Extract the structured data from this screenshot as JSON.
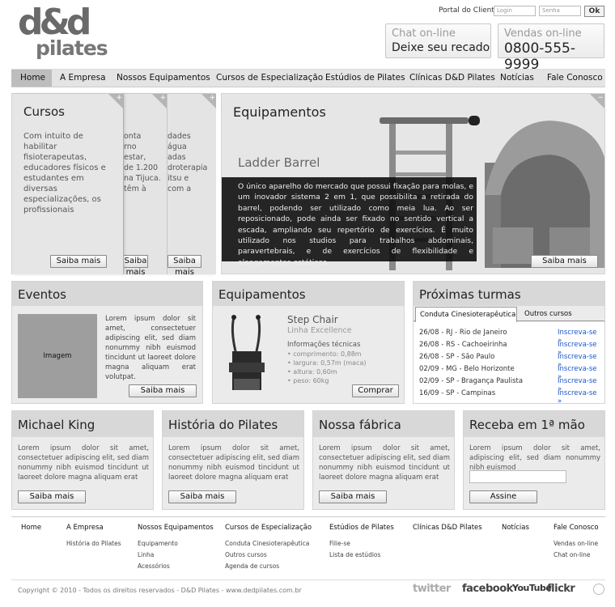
{
  "header": {
    "logo_text": "d&d",
    "logo_sub": "pilates",
    "portal_label": "Portal do Cliente:",
    "login_placeholder": "Login",
    "password_placeholder": "Senha",
    "ok_label": "Ok",
    "chat_line1": "Chat on-line",
    "chat_line2": "Deixe seu recado",
    "sales_line1": "Vendas on-line",
    "sales_line2": "0800-555-9999"
  },
  "nav": [
    "Home",
    "A Empresa",
    "Nossos Equipamentos",
    "Cursos de Especialização",
    "Estúdios de Pilates",
    "Clínicas D&D Pilates",
    "Notícias",
    "Fale Conosco"
  ],
  "cursos": {
    "title": "Cursos",
    "text": "Com intuito de habilitar fisioterapeutas, educadores físicos e estudantes em diversas especializações, os profissionais",
    "back1_lines": [
      "onta",
      "rno",
      "estar,",
      "de 1.200",
      "na Tijuca.",
      "têm à"
    ],
    "back2_lines": [
      "dades",
      "água",
      "adas",
      "droterapia",
      "itsu e",
      "com a"
    ],
    "button": "Saiba mais",
    "plus": "+"
  },
  "equip_feature": {
    "title": "Equipamentos",
    "subtitle": "Ladder Barrel",
    "text": "O único aparelho do mercado que possui fixação para molas, e um inovador sistema 2 em 1, que possibilita a retirada do barrel, podendo ser utilizado como meia lua. Ao ser reposicionado, pode ainda ser fixado no sentido vertical a escada, ampliando seu repertório de exercícios. É muito utilizado nos studios para trabalhos abdominais, paravertebrais, e de exercícios de flexibilidade e alongamentos estáticos.",
    "button": "Saiba mais",
    "minus": "−"
  },
  "eventos": {
    "title": "Eventos",
    "image_label": "Imagem",
    "text": "Lorem ipsum dolor sit amet, consectetuer adipiscing elit, sed diam nonummy nibh euismod tincidunt ut laoreet dolore magna aliquam erat volutpat.",
    "button": "Saiba mais"
  },
  "equip_small": {
    "title": "Equipamentos",
    "product": "Step Chair",
    "line": "Linha Excellence",
    "info_title": "Informações técnicas",
    "specs": [
      "• comprimento: 0,88m",
      "• largura: 0,57m (maca)",
      "• altura: 0,60m",
      "• peso: 60kg"
    ],
    "button": "Comprar"
  },
  "turmas": {
    "title": "Próximas turmas",
    "tab_active": "Conduta Cinesioterapêutica",
    "tab_other": "Outros cursos",
    "rows": [
      {
        "date": "26/08 - RJ - Rio de Janeiro",
        "link": "Inscreva-se »"
      },
      {
        "date": "26/08 - RS - Cachoeirinha",
        "link": "Inscreva-se »"
      },
      {
        "date": "26/08 - SP - São Paulo",
        "link": "Inscreva-se »"
      },
      {
        "date": "02/09 - MG - Belo Horizonte",
        "link": "Inscreva-se »"
      },
      {
        "date": "02/09 - SP - Bragança Paulista",
        "link": "Inscreva-se »"
      },
      {
        "date": "16/09 - SP - Campinas",
        "link": "Inscreva-se »"
      }
    ]
  },
  "row3": [
    {
      "title": "Michael King",
      "text": "Lorem ipsum dolor sit amet, consectetuer adipiscing elit, sed diam nonummy nibh euismod tincidunt ut laoreet dolore magna aliquam erat",
      "button": "Saiba mais"
    },
    {
      "title": "História do Pilates",
      "text": "Lorem ipsum dolor sit amet, consectetuer adipiscing elit, sed diam nonummy nibh euismod tincidunt ut laoreet dolore magna aliquam erat",
      "button": "Saiba mais"
    },
    {
      "title": "Nossa fábrica",
      "text": "Lorem ipsum dolor sit amet, consectetuer adipiscing elit, sed diam nonummy nibh euismod tincidunt ut laoreet dolore magna aliquam erat",
      "button": "Saiba mais"
    },
    {
      "title": "Receba em 1ª mão",
      "text": "Lorem ipsum dolor sit amet, adipiscing elit, sed diam nonummy nibh euismod",
      "button": "Assine"
    }
  ],
  "footer": {
    "cols": [
      {
        "head": "Home",
        "subs": []
      },
      {
        "head": "A Empresa",
        "subs": [
          "História do Pilates"
        ]
      },
      {
        "head": "Nossos Equipamentos",
        "subs": [
          "Equipamento",
          "Linha",
          "Acessórios"
        ]
      },
      {
        "head": "Cursos de Especialização",
        "subs": [
          "Conduta Cinesioterapêutica",
          "Outros cursos",
          "Agenda de cursos"
        ]
      },
      {
        "head": "Estúdios de Pilates",
        "subs": [
          "Filie-se",
          "Lista de estúdios"
        ]
      },
      {
        "head": "Clínicas D&D Pilates",
        "subs": []
      },
      {
        "head": "Notícias",
        "subs": []
      },
      {
        "head": "Fale Conosco",
        "subs": [
          "Vendas on-line",
          "Chat on-line"
        ]
      }
    ],
    "copyright": "Copyright © 2010 - Todos os direitos reservados - D&D Pilates - www.dedpilates.com.br",
    "social": [
      "twitter",
      "facebook",
      "YouTube",
      "flickr"
    ]
  }
}
